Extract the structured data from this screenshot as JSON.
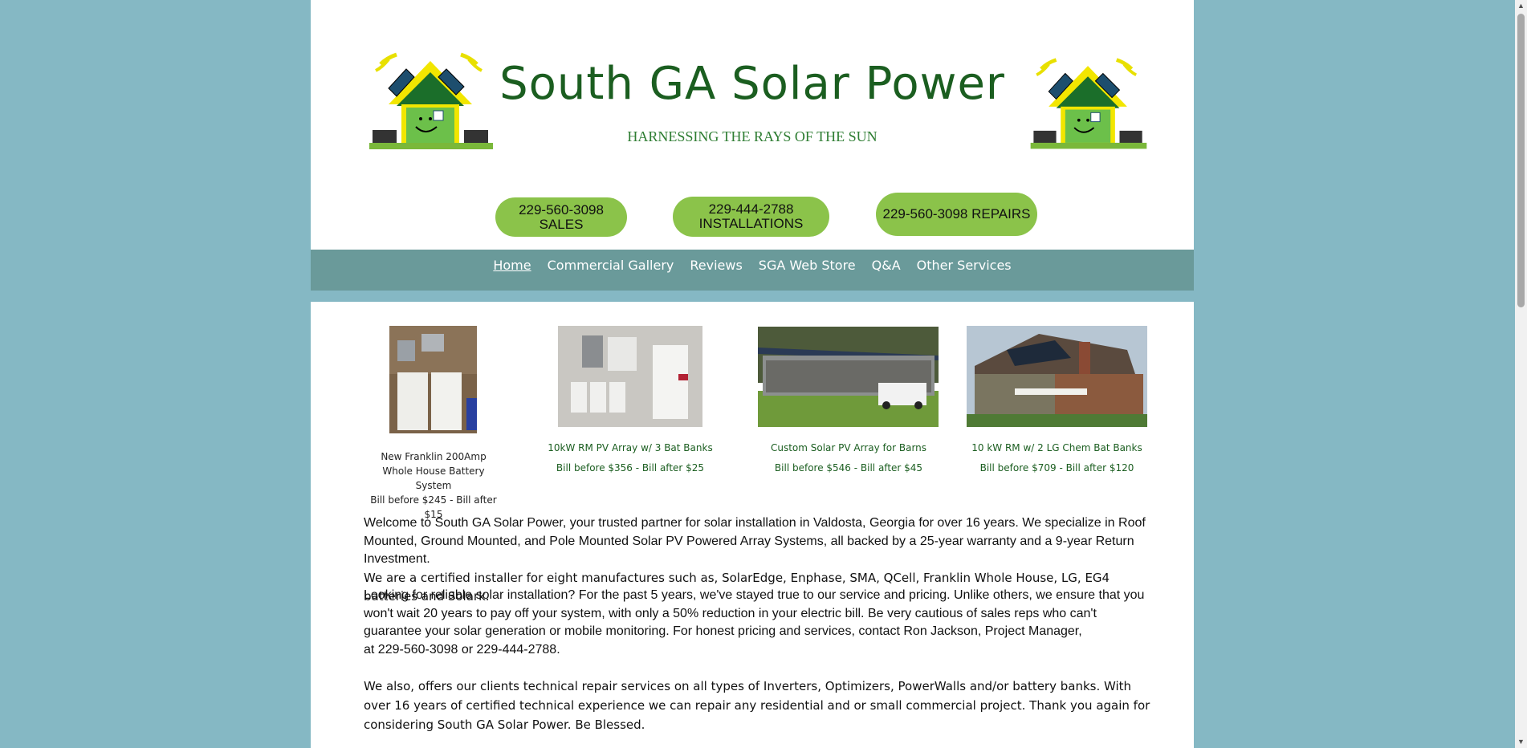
{
  "header": {
    "title": "South GA Solar Power",
    "tagline": "HARNESSING THE RAYS OF THE SUN"
  },
  "buttons": {
    "sales": "229-560-3098 SALES",
    "installations": "229-444-2788 INSTALLATIONS",
    "repairs": "229-560-3098 REPAIRS"
  },
  "nav": [
    "Home",
    "Commercial Gallery",
    "Reviews",
    "SGA Web Store",
    "Q&A",
    "Other Services"
  ],
  "gallery": [
    {
      "title": "New Franklin 200Amp Whole House Battery System",
      "bill": "Bill before $245 - Bill after $15"
    },
    {
      "title": "10kW RM PV Array w/ 3 Bat Banks",
      "bill": "Bill before $356 - Bill after $25"
    },
    {
      "title": "Custom Solar PV Array for Barns",
      "bill": "Bill before $546 - Bill after $45"
    },
    {
      "title": "10 kW RM w/ 2 LG Chem Bat Banks",
      "bill": "Bill before $709 - Bill after $120"
    }
  ],
  "body": {
    "p1": "Welcome to South GA Solar Power, your trusted partner for solar installation in Valdosta, Georgia for over 16 years. We specialize in Roof Mounted, Ground Mounted, and Pole Mounted Solar PV Powered Array Systems, all backed by a 25-year warranty and a 9-year Return Investment.",
    "p2": "We are a certified installer for eight manufactures such as, SolarEdge, Enphase, SMA, QCell, Franklin Whole House, LG, EG4 batteries and Solark.",
    "p3": "Looking for reliable solar installation? For the past 5 years, we've stayed true to our service and pricing. Unlike others, we ensure that you won't wait 20 years to pay off your system, with only a 50% reduction in your electric bill. Be very cautious of sales reps who can't guarantee your solar generation or mobile monitoring. For honest pricing and services, contact Ron Jackson, Project Manager,",
    "p3b": "at 229-560-3098 or 229-444-2788.",
    "p4": "We also, offers our clients technical repair services on all types of  Inverters, Optimizers, PowerWalls and/or battery banks. With over 16 years of certified technical experience we can repair any residential and or small commercial project. Thank you again for considering South GA Solar Power.  Be Blessed."
  },
  "colors": {
    "page_bg": "#85b8c4",
    "nav_bg": "#6a9a9a",
    "button": "#8bc34a",
    "title": "#1b5e20"
  }
}
